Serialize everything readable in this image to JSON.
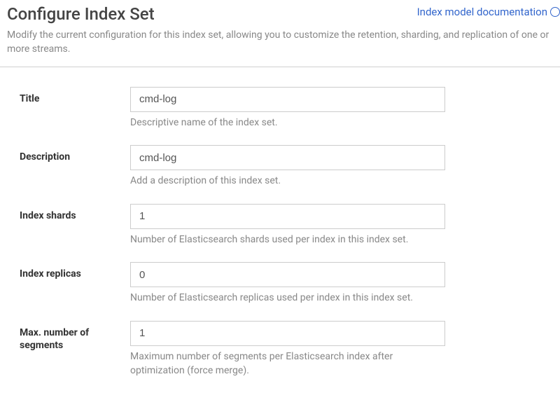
{
  "header": {
    "title": "Configure Index Set",
    "description": "Modify the current configuration for this index set, allowing you to customize the retention, sharding, and replication of one or more streams.",
    "doc_link_label": "Index model documentation"
  },
  "form": {
    "title": {
      "label": "Title",
      "value": "cmd-log",
      "help": "Descriptive name of the index set."
    },
    "description": {
      "label": "Description",
      "value": "cmd-log",
      "help": "Add a description of this index set."
    },
    "shards": {
      "label": "Index shards",
      "value": "1",
      "help": "Number of Elasticsearch shards used per index in this index set."
    },
    "replicas": {
      "label": "Index replicas",
      "value": "0",
      "help": "Number of Elasticsearch replicas used per index in this index set."
    },
    "segments": {
      "label": "Max. number of segments",
      "value": "1",
      "help": "Maximum number of segments per Elasticsearch index after optimization (force merge)."
    }
  }
}
